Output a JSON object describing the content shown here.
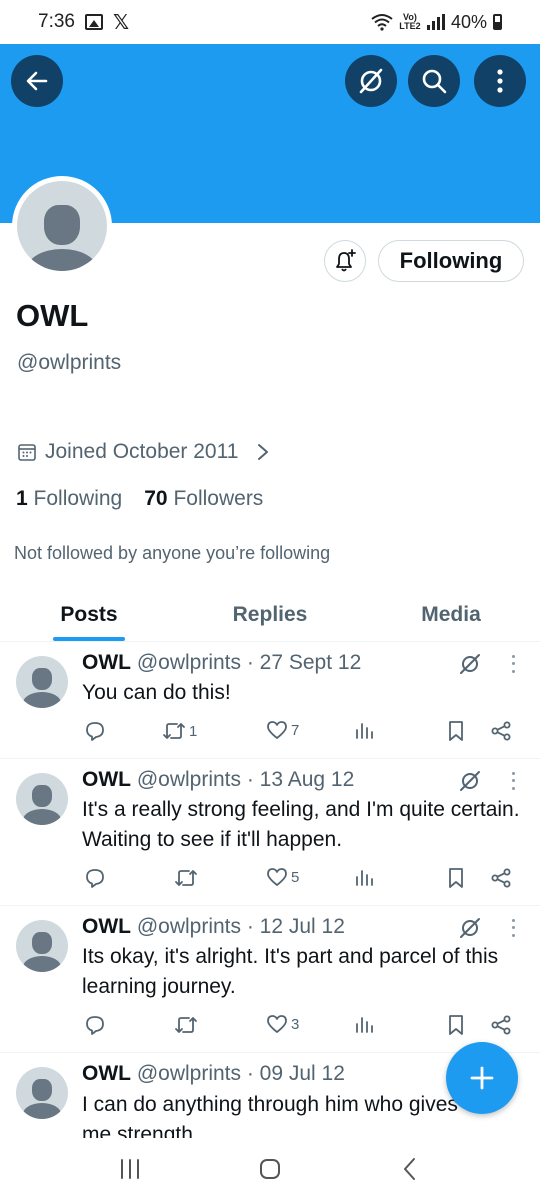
{
  "status_bar": {
    "time": "7:36",
    "network_label": "Vo) LTE2",
    "battery": "40%",
    "icons": [
      "gallery-icon",
      "x-logo-icon",
      "wifi-icon",
      "signal-icon",
      "battery-icon"
    ]
  },
  "header": {
    "banner_color": "#1d9bf0",
    "buttons": [
      "back-arrow-icon",
      "grok-icon",
      "search-icon",
      "more-vertical-icon"
    ]
  },
  "profile": {
    "name": "OWL",
    "handle": "@owlprints",
    "following_button": "Following",
    "joined": "Joined October 2011",
    "following_count": "1",
    "following_label": "Following",
    "followers_count": "70",
    "followers_label": "Followers",
    "not_followed_text": "Not followed by anyone you’re following"
  },
  "tabs": [
    {
      "label": "Posts",
      "active": true
    },
    {
      "label": "Replies",
      "active": false
    },
    {
      "label": "Media",
      "active": false
    }
  ],
  "posts": [
    {
      "name": "OWL",
      "meta": "@owlprints · 27 Sept 12",
      "text": "You can do this!",
      "retweets": "1",
      "likes": "7"
    },
    {
      "name": "OWL",
      "meta": "@owlprints · 13 Aug 12",
      "text": "It's a really strong feeling, and I'm quite certain. Waiting to see if it'll happen.",
      "retweets": "",
      "likes": "5"
    },
    {
      "name": "OWL",
      "meta": "@owlprints · 12 Jul 12",
      "text": "Its okay, it's alright. It's part and parcel of this learning journey.",
      "retweets": "",
      "likes": "3"
    },
    {
      "name": "OWL",
      "meta": "@owlprints · 09 Jul 12",
      "text": "I can do anything through him who gives me strength",
      "retweets": "",
      "likes": ""
    }
  ],
  "colors": {
    "accent": "#1d9bf0",
    "button_dark": "#114166",
    "text_primary": "#0f1419",
    "text_secondary": "#536471",
    "avatar_bg": "#cfd9de",
    "avatar_fg": "#687783"
  }
}
